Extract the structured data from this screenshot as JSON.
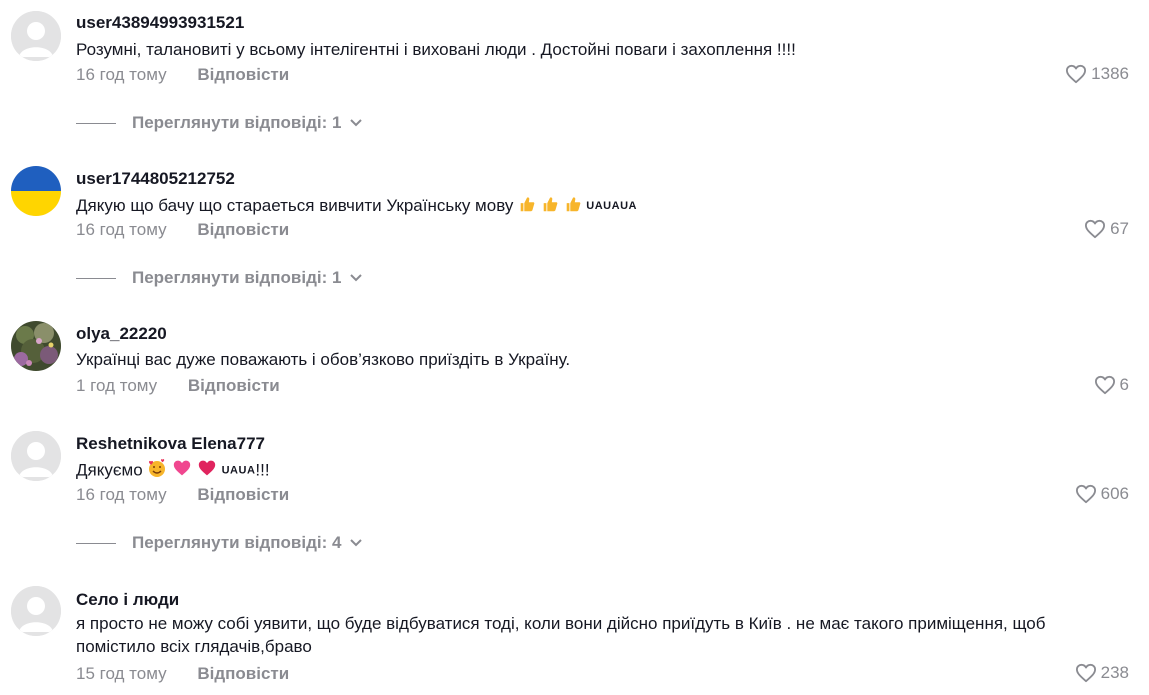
{
  "comments": [
    {
      "username": "user43894993931521",
      "text": "Розумні, талановиті у всьому інтелігентні і виховані люди . Достойні поваги і захоплення !!!!",
      "time": "16 год тому",
      "reply_label": "Відповісти",
      "likes": "1386",
      "view_replies": "Переглянути відповіді: 1",
      "avatar": "default-avatar"
    },
    {
      "username": "user1744805212752",
      "text": "Дякую що бачу що стараеться вивчити Українську мову",
      "text_suffix": "UAUAUA",
      "time": "16 год тому",
      "reply_label": "Відповісти",
      "likes": "67",
      "view_replies": "Переглянути відповіді: 1",
      "avatar": "ukraine-flag-avatar"
    },
    {
      "username": "olya_22220",
      "text": "Українці вас дуже поважають і обов’язково приїздіть в Україну.",
      "time": "1 год тому",
      "reply_label": "Відповісти",
      "likes": "6",
      "avatar": "flowers-photo-avatar"
    },
    {
      "username": "Reshetnikova Elena777",
      "text": "Дякуємо",
      "text_suffix": "UAUA",
      "text_end": "!!!",
      "time": "16 год тому",
      "reply_label": "Відповісти",
      "likes": "606",
      "view_replies": "Переглянути відповіді: 4",
      "avatar": "default-avatar"
    },
    {
      "username": "Село і люди",
      "text": "я просто не можу собі уявити, що буде відбуватися тоді, коли вони дійсно приїдуть в Київ . не має такого приміщення, щоб помістило всіх глядачів,браво",
      "time": "15 год тому",
      "reply_label": "Відповісти",
      "likes": "238",
      "avatar": "default-avatar"
    }
  ],
  "colors": {
    "text": "#161823",
    "muted": "#8a8b91",
    "avatar_bg": "#e3e3e4",
    "flag_blue": "#1f5fbf",
    "flag_yellow": "#ffd500"
  }
}
